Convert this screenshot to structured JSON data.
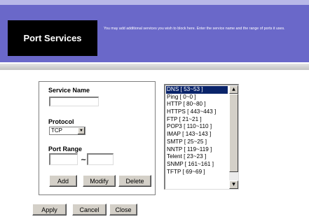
{
  "header": {
    "title": "Port Services",
    "description": "You may add additional services you wish to block here. Enter the service name and the range of ports it uses."
  },
  "form": {
    "service_name_label": "Service Name",
    "service_name_value": "",
    "protocol_label": "Protocol",
    "protocol_selected": "TCP",
    "port_range_label": "Port Range",
    "port_range_separator": "~",
    "port_start_value": "",
    "port_end_value": ""
  },
  "panel_buttons": {
    "add": "Add",
    "modify": "Modify",
    "delete": "Delete"
  },
  "services": [
    "DNS [ 53~53 ]",
    "Ping [ 0~0 ]",
    "HTTP [ 80~80 ]",
    "HTTPS [ 443~443 ]",
    "FTP [ 21~21 ]",
    "POP3 [ 110~110 ]",
    "IMAP [ 143~143 ]",
    "SMTP [ 25~25 ]",
    "NNTP [ 119~119 ]",
    "Telent [ 23~23 ]",
    "SNMP [ 161~161 ]",
    "TFTP [ 69~69 ]"
  ],
  "selected_service": "DNS [ 53~53 ]",
  "footer_buttons": {
    "apply": "Apply",
    "cancel": "Cancel",
    "close": "Close"
  },
  "colors": {
    "header_band": "#6a68c9",
    "title_block": "#000000",
    "selection": "#0a246a"
  }
}
